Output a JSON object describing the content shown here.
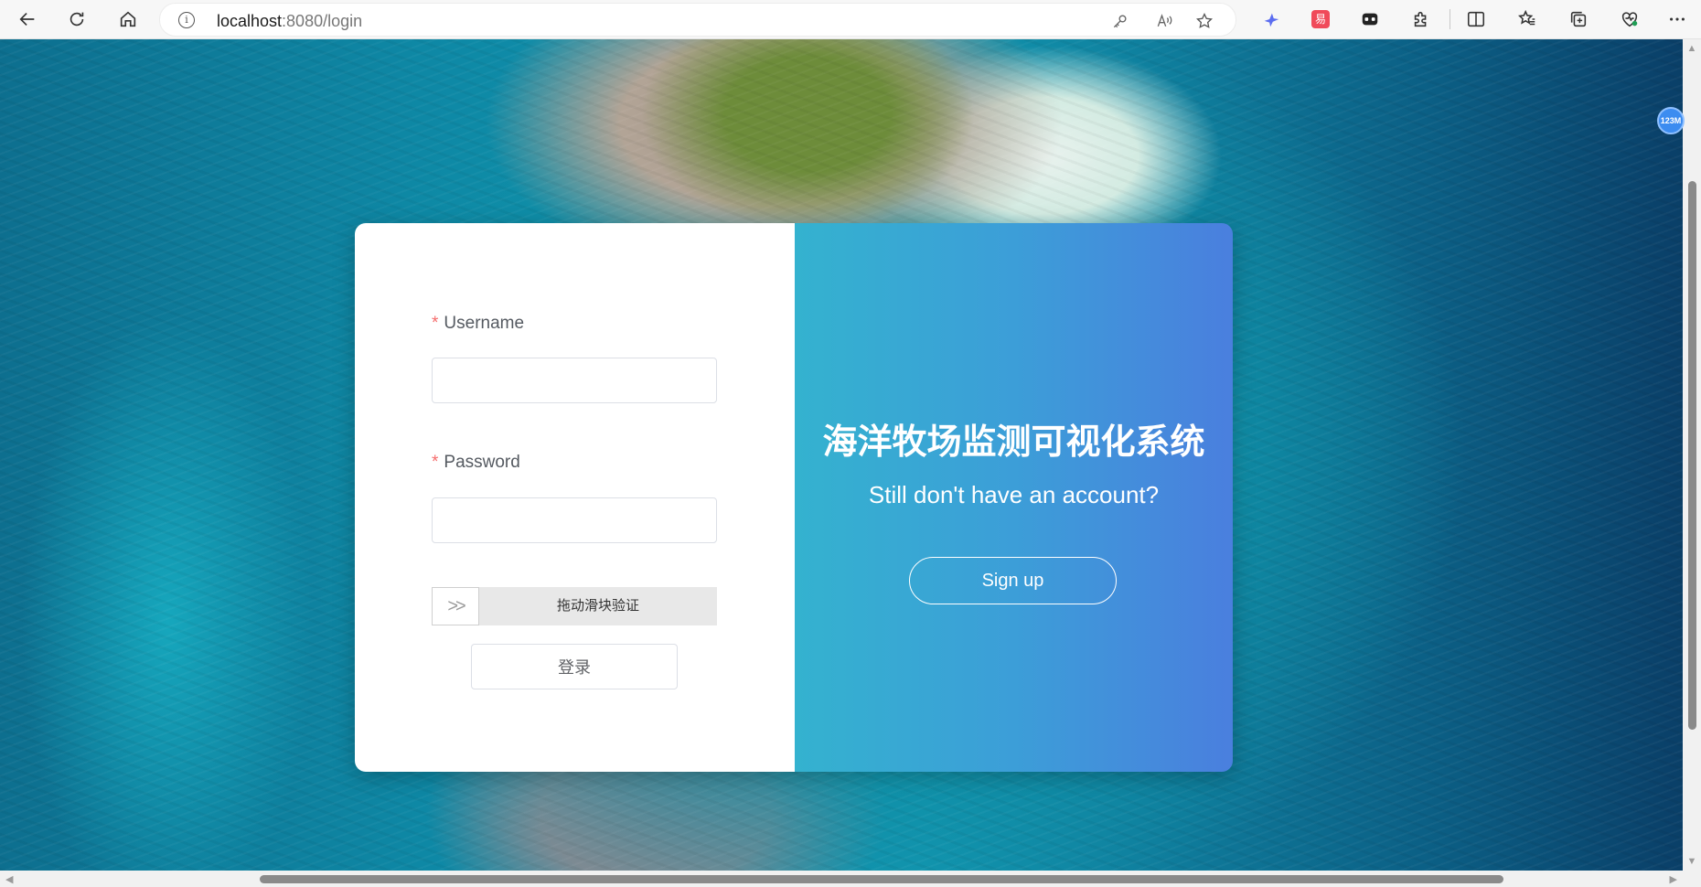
{
  "browser": {
    "url_host": "localhost",
    "url_rest": ":8080/login",
    "icons": {
      "back": "back-arrow-icon",
      "reload": "reload-icon",
      "home": "home-icon",
      "site_info": "info-icon",
      "password_key": "key-icon",
      "read_aloud": "read-aloud-icon",
      "favorite": "star-icon",
      "split_screen": "split-screen-icon",
      "favorites_list": "favorites-icon",
      "collections": "collections-icon",
      "performance": "performance-icon",
      "more": "more-icon"
    },
    "ext_badge_text": "易"
  },
  "login": {
    "username_label": "Username",
    "username_value": "",
    "password_label": "Password",
    "password_value": "",
    "required_mark": "*",
    "slider_handle": ">>",
    "slider_text": "拖动滑块验证",
    "login_button": "登录"
  },
  "register_panel": {
    "title": "海洋牧场监测可视化系统",
    "subtitle": "Still don't have an account?",
    "signup_button": "Sign up"
  },
  "memory_badge": "123M",
  "colors": {
    "gradient_start": "#34b2cf",
    "gradient_end": "#4a7fde",
    "required": "#f56c6c"
  }
}
